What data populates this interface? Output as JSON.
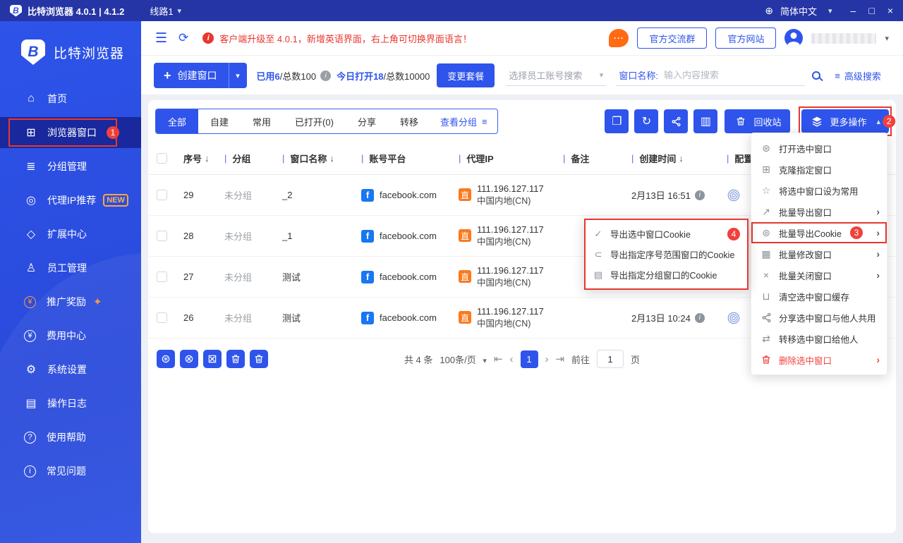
{
  "titlebar": {
    "logo_letter": "B",
    "app_title": "比特浏览器 4.0.1 | 4.1.2",
    "line_selector": "线路1",
    "language": "简体中文"
  },
  "sidebar": {
    "logo_text": "比特浏览器",
    "items": [
      {
        "id": "home",
        "icon": "home",
        "label": "首页"
      },
      {
        "id": "browser-windows",
        "icon": "windows",
        "label": "浏览器窗口",
        "active": true,
        "badge": "1"
      },
      {
        "id": "group-manage",
        "icon": "groups",
        "label": "分组管理"
      },
      {
        "id": "proxy-ip",
        "icon": "proxy",
        "label": "代理IP推荐",
        "tag": "NEW"
      },
      {
        "id": "extension-center",
        "icon": "extension",
        "label": "扩展中心"
      },
      {
        "id": "staff-manage",
        "icon": "staff",
        "label": "员工管理"
      },
      {
        "id": "promotion",
        "icon": "promo",
        "label": "推广奖励",
        "circle": true,
        "orange": true,
        "sparkle": "✦"
      },
      {
        "id": "billing",
        "icon": "fee",
        "label": "费用中心",
        "circle": true
      },
      {
        "id": "system-settings",
        "icon": "settings",
        "label": "系统设置"
      },
      {
        "id": "operation-log",
        "icon": "logs",
        "label": "操作日志"
      },
      {
        "id": "help",
        "icon": "help",
        "label": "使用帮助",
        "circle": true
      },
      {
        "id": "faq",
        "icon": "faq",
        "label": "常见问题",
        "circle": true
      }
    ]
  },
  "header": {
    "notice": "客户端升级至 4.0.1，新增英语界面，右上角可切换界面语言！",
    "group_button": "官方交流群",
    "site_button": "官方网站"
  },
  "toolbar": {
    "create_button": "创建窗口",
    "used_bold": "已用6",
    "used_rest": " /总数100",
    "today_bold": "今日打开18",
    "today_rest": "/总数10000",
    "plan_button": "变更套餐",
    "employee_placeholder": "选择员工账号搜索",
    "window_name_label": "窗口名称:",
    "window_name_placeholder": "输入内容搜索",
    "advanced_search": "高级搜索"
  },
  "tabs": {
    "items": [
      "全部",
      "自建",
      "常用",
      "已打开(0)",
      "分享",
      "转移"
    ],
    "active_index": 0,
    "view_group": "查看分组"
  },
  "actions": {
    "square_buttons": [
      {
        "id": "batch-open-windows",
        "icon": "dup"
      },
      {
        "id": "refresh-list",
        "icon": "refresh2"
      },
      {
        "id": "share-windows",
        "icon": "shareSvg"
      },
      {
        "id": "list-view",
        "icon": "layout"
      }
    ],
    "recycle_label": "回收站",
    "more_label": "更多操作",
    "more_badge": "2"
  },
  "table": {
    "columns": [
      {
        "label": "序号",
        "sort": true,
        "pipe": false,
        "cls": "c-seq"
      },
      {
        "label": "分组",
        "pipe": true,
        "cls": "c-group"
      },
      {
        "label": "窗口名称",
        "sort": true,
        "pipe": true,
        "cls": "c-name"
      },
      {
        "label": "账号平台",
        "pipe": true,
        "cls": "c-platform"
      },
      {
        "label": "代理IP",
        "pipe": true,
        "cls": "c-ip"
      },
      {
        "label": "备注",
        "pipe": true,
        "cls": "c-note"
      },
      {
        "label": "创建时间",
        "sort": true,
        "pipe": true,
        "cls": "c-time"
      },
      {
        "label": "配置",
        "pipe": true,
        "cls": "c-config"
      }
    ],
    "rows": [
      {
        "seq": "29",
        "group": "未分组",
        "name": "_2",
        "platform": "facebook.com",
        "proxy_tag": "直",
        "ip": "111.196.127.117",
        "location": "中国内地(CN)",
        "note": "",
        "created": "2月13日 16:51"
      },
      {
        "seq": "28",
        "group": "未分组",
        "name": "_1",
        "platform": "facebook.com",
        "proxy_tag": "直",
        "ip": "111.196.127.117",
        "location": "中国内地(CN)",
        "note": "",
        "created": ""
      },
      {
        "seq": "27",
        "group": "未分组",
        "name": "测试",
        "platform": "facebook.com",
        "proxy_tag": "直",
        "ip": "111.196.127.117",
        "location": "中国内地(CN)",
        "note": "",
        "created": ""
      },
      {
        "seq": "26",
        "group": "未分组",
        "name": "测试",
        "platform": "facebook.com",
        "proxy_tag": "直",
        "ip": "111.196.127.117",
        "location": "中国内地(CN)",
        "note": "",
        "created": "2月13日 10:24"
      }
    ]
  },
  "bottom_icons": [
    {
      "id": "batch-open-selected",
      "icon": "open"
    },
    {
      "id": "close-selected",
      "icon": "closeCircle"
    },
    {
      "id": "close-all",
      "icon": "closeSquare"
    },
    {
      "id": "recycle-selected",
      "icon": "trashSvg"
    },
    {
      "id": "delete-selected",
      "icon": "trashSvg"
    }
  ],
  "pagination": {
    "total": "共 4 条",
    "per_page": "100条/页",
    "current_page": "1",
    "goto_label": "前往",
    "goto_value": "1",
    "page_unit": "页"
  },
  "more_menu": {
    "items": [
      {
        "id": "open-selected-window",
        "icon": "mOpen",
        "label": "打开选中窗口"
      },
      {
        "id": "clone-window",
        "icon": "mClone",
        "label": "克隆指定窗口"
      },
      {
        "id": "set-common",
        "icon": "mStar",
        "label": "将选中窗口设为常用"
      },
      {
        "id": "batch-export-window",
        "icon": "mExport",
        "label": "批量导出窗口",
        "arrow": true
      },
      {
        "id": "batch-export-cookie",
        "icon": "mCookie",
        "label": "批量导出Cookie",
        "arrow": true,
        "badge": "3",
        "highlight": true
      },
      {
        "id": "batch-modify-window",
        "icon": "mModify",
        "label": "批量修改窗口",
        "arrow": true
      },
      {
        "id": "batch-close-window",
        "icon": "mClose",
        "label": "批量关闭窗口",
        "arrow": true
      },
      {
        "id": "clear-cache",
        "icon": "mBroom",
        "label": "清空选中窗口缓存"
      },
      {
        "id": "share-window",
        "icon": "mShare",
        "label": "分享选中窗口与他人共用"
      },
      {
        "id": "transfer-window",
        "icon": "mTransfer",
        "label": "转移选中窗口给他人"
      },
      {
        "id": "delete-window",
        "icon": "mTrash",
        "label": "删除选中窗口",
        "arrow": true,
        "danger": true
      }
    ]
  },
  "cookie_submenu": {
    "items": [
      {
        "id": "export-selected-cookie",
        "icon": "sCheck",
        "label": "导出选中窗口Cookie",
        "badge": "4"
      },
      {
        "id": "export-range-cookie",
        "icon": "sRange",
        "label": "导出指定序号范围窗口的Cookie"
      },
      {
        "id": "export-group-cookie",
        "icon": "sGroup",
        "label": "导出指定分组窗口的Cookie"
      }
    ]
  },
  "icons": {
    "home": "⌂",
    "windows": "⊞",
    "groups": "≣",
    "proxy": "◎",
    "extension": "◇",
    "staff": "♙",
    "promo": "¥",
    "fee": "¥",
    "settings": "⚙",
    "logs": "▤",
    "help": "?",
    "faq": "i",
    "globe": "⊕",
    "caret_down": "▾",
    "caret_up": "▴",
    "collapse": "☰",
    "refresh": "⟳",
    "plus": "+",
    "info": "i",
    "filter": "≡",
    "sort_desc": "↓",
    "pipe": "|",
    "dup": "❐",
    "refresh2": "↻",
    "layout": "▥",
    "open": "⊛",
    "closeCircle": "⊗",
    "closeSquare": "⊠",
    "mOpen": "⊛",
    "mClone": "⊞",
    "mStar": "☆",
    "mExport": "↗",
    "mCookie": "⊚",
    "mModify": "▦",
    "mClose": "×",
    "mBroom": "⊔",
    "mTransfer": "⇄",
    "sCheck": "✓",
    "sRange": "⊂",
    "sGroup": "▤",
    "pg_first": "⇤",
    "pg_prev": "‹",
    "pg_next": "›",
    "pg_last": "⇥",
    "fb": "f",
    "min": "–",
    "max": "□",
    "close": "×"
  },
  "colors": {
    "primary": "#2f54eb",
    "sidebar": "#2b50e5",
    "titlebar": "#2635a6",
    "red_frame": "#e8372f",
    "badge": "#f0413d",
    "orange": "#fa7a1f",
    "facebook": "#1877f2"
  }
}
